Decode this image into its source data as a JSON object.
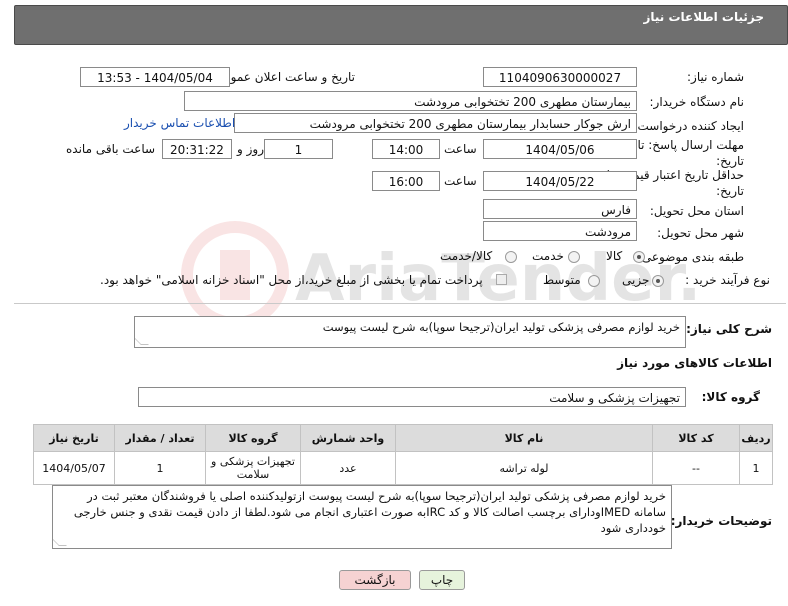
{
  "header": {
    "title": "جزئیات اطلاعات نیاز"
  },
  "fields": {
    "need_number_label": "شماره نیاز:",
    "need_number": "1104090630000027",
    "announce_label": "تاریخ و ساعت اعلان عمومی:",
    "announce_value": "1404/05/04 - 13:53",
    "buyer_org_label": "نام دستگاه خریدار:",
    "buyer_org": "بیمارستان مطهری  200 تختخوابی مرودشت",
    "requester_label": "ایجاد کننده درخواست:",
    "requester": "ارش  جوکار حسابدار بیمارستان مطهری  200 تختخوابی مرودشت",
    "contact_link": "اطلاعات تماس خریدار",
    "reply_deadline_label": "مهلت ارسال پاسخ: تا تاریخ:",
    "reply_date": "1404/05/06",
    "time_label": "ساعت",
    "reply_time": "14:00",
    "days_value": "1",
    "days_label": "روز و",
    "remaining_time": "20:31:22",
    "remaining_label": "ساعت باقی مانده",
    "price_validity_label": "حداقل تاریخ اعتبار قیمت: تا تاریخ:",
    "price_date": "1404/05/22",
    "price_time": "16:00",
    "province_label": "استان محل تحویل:",
    "province": "فارس",
    "city_label": "شهر محل تحویل:",
    "city": "مرودشت",
    "category_label": "طبقه بندی موضوعی:",
    "category_options": [
      "کالا",
      "خدمت",
      "کالا/خدمت"
    ],
    "purchase_type_label": "نوع فرآیند خرید :",
    "purchase_options": [
      "جزیی",
      "متوسط"
    ],
    "payment_note": "پرداخت تمام یا بخشی از مبلغ خرید،از محل \"اسناد خزانه اسلامی\" خواهد بود."
  },
  "description": {
    "label": "شرح کلی نیاز:",
    "text": "خرید لوازم مصرفی پزشکی تولید ایران(ترجیحا سوپا)به شرح لیست پیوست"
  },
  "goods": {
    "section_title": "اطلاعات کالاهای مورد نیاز",
    "group_label": "گروه کالا:",
    "group_value": "تجهیزات پزشکی و سلامت",
    "columns": [
      "ردیف",
      "کد کالا",
      "نام کالا",
      "واحد شمارش",
      "گروه کالا",
      "تعداد / مقدار",
      "تاریخ نیاز"
    ],
    "rows": [
      {
        "row": "1",
        "code": "--",
        "name": "لوله تراشه",
        "unit": "عدد",
        "group": "تجهیزات پزشکی و سلامت",
        "qty": "1",
        "date": "1404/05/07"
      }
    ]
  },
  "buyer_notes": {
    "label": "توضیحات خریدار:",
    "text": "خرید لوازم مصرفی پزشکی تولید ایران(ترجیحا سوپا)به شرح لیست پیوست ازتولیدکننده اصلی یا فروشندگان معتبر ثبت در سامانه IMEDودارای برچسب اصالت کالا و کد IRCبه صورت اعتباری انجام می شود.لطفا از دادن قیمت نقدی و جنس خارجی خودداری شود"
  },
  "buttons": {
    "print": "چاپ",
    "back": "بازگشت"
  },
  "watermark": "AriaTender.net",
  "colors": {
    "header_bg": "#6f6f6f",
    "link": "#1a4fb0",
    "back_btn_bg": "#f6d2d2",
    "print_btn_bg": "#e6f3dc"
  }
}
